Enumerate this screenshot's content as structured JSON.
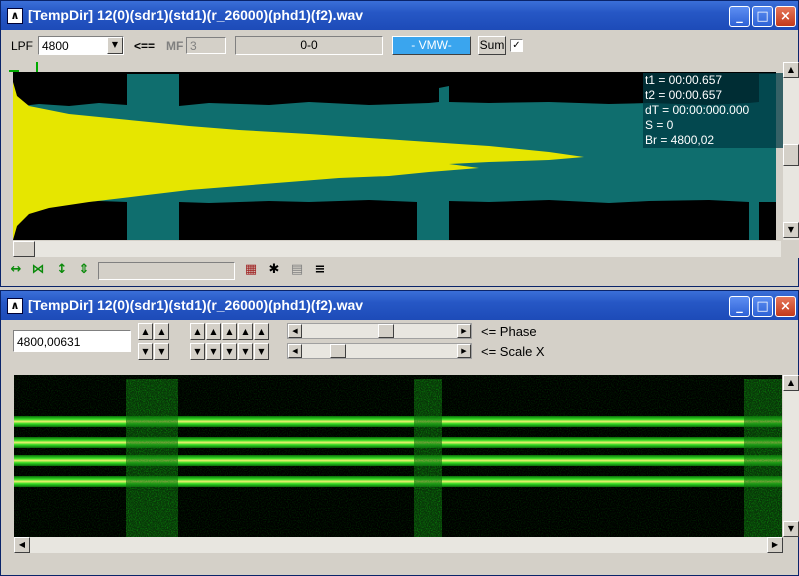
{
  "window_top": {
    "title": "[TempDir] 12(0)(sdr1)(std1)(r_26000)(phd1)(f2).wav",
    "controls": {
      "minimize": "_",
      "maximize": "□",
      "close": "×"
    },
    "toolbar": {
      "lpf_label": "LPF",
      "lpf_value": "4800",
      "arrow_label": "<==",
      "mf_label": "MF",
      "mf_value": "3",
      "range_display": "0-0",
      "vmw_label": "- VMW-",
      "sum_label": "Sum",
      "sum_checked": "✓"
    },
    "info": {
      "t1": "t1 = 00:00.657",
      "t2": "t2 = 00:00.657",
      "dt": "dT = 00:00:000.000",
      "s": "S = 0",
      "br": "Br = 4800,02"
    },
    "bottom_icons": [
      "↔",
      "⋈",
      "↕",
      "⇕",
      "▦",
      "✱",
      "▤",
      "≡"
    ]
  },
  "window_bottom": {
    "title": "[TempDir] 12(0)(sdr1)(std1)(r_26000)(phd1)(f2).wav",
    "controls": {
      "minimize": "_",
      "maximize": "□",
      "close": "×"
    },
    "freq_value": "4800,00631",
    "phase_label": "<= Phase",
    "scale_label": "<= Scale X",
    "phase_level": 0.55,
    "scale_level": 0.2
  },
  "colors": {
    "titlebar": "#2657c5",
    "spectrum_teal": "#0f6e6e",
    "spectrum_yellow": "#e6e600",
    "eye_green": "#22dd22",
    "eye_yellow": "#f0f070"
  }
}
